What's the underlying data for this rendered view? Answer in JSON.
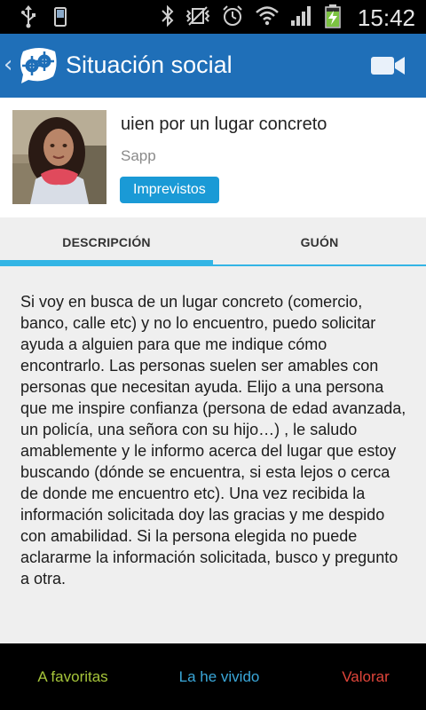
{
  "status_bar": {
    "time": "15:42",
    "icons": [
      "usb-icon",
      "sd-card-icon",
      "bluetooth-icon",
      "vibrate-icon",
      "alarm-icon",
      "wifi-icon",
      "signal-icon",
      "battery-charging-icon"
    ]
  },
  "app_bar": {
    "title": "Situación social",
    "back_icon": "chevron-left-icon",
    "logo_icon": "app-logo-icon",
    "action_icon": "video-camera-icon"
  },
  "situation": {
    "title": "uien por un lugar concreto",
    "author": "Sapp",
    "tag": "Imprevistos"
  },
  "tabs": [
    {
      "label": "DESCRIPCIÓN",
      "active": true
    },
    {
      "label": "GUÓN",
      "active": false
    }
  ],
  "description": "Si voy en busca de un lugar concreto (comercio, banco, calle etc) y no lo encuentro, puedo solicitar ayuda a alguien para que me indique cómo encontrarlo. Las personas suelen ser amables con personas que necesitan ayuda. Elijo a una persona que me inspire confianza (persona de edad avanzada, un policía, una señora con su hijo…) , le saludo amablemente y le informo acerca del lugar que estoy buscando (dónde se encuentra, si esta lejos o cerca de donde me encuentro etc). Una vez recibida la información solicitada doy las gracias y me despido con amabilidad. Si la persona elegida no puede aclararme la información solicitada, busco y pregunto a otra.",
  "bottom_actions": {
    "favorites": "A favoritas",
    "lived": "La he vivido",
    "rate": "Valorar"
  },
  "colors": {
    "app_bar": "#1f6fb8",
    "tab_indicator": "#33b5e5",
    "tag_badge": "#1a9ad6",
    "favorites": "#a6c53a",
    "lived": "#3aa7d9",
    "rate": "#e0453a"
  }
}
